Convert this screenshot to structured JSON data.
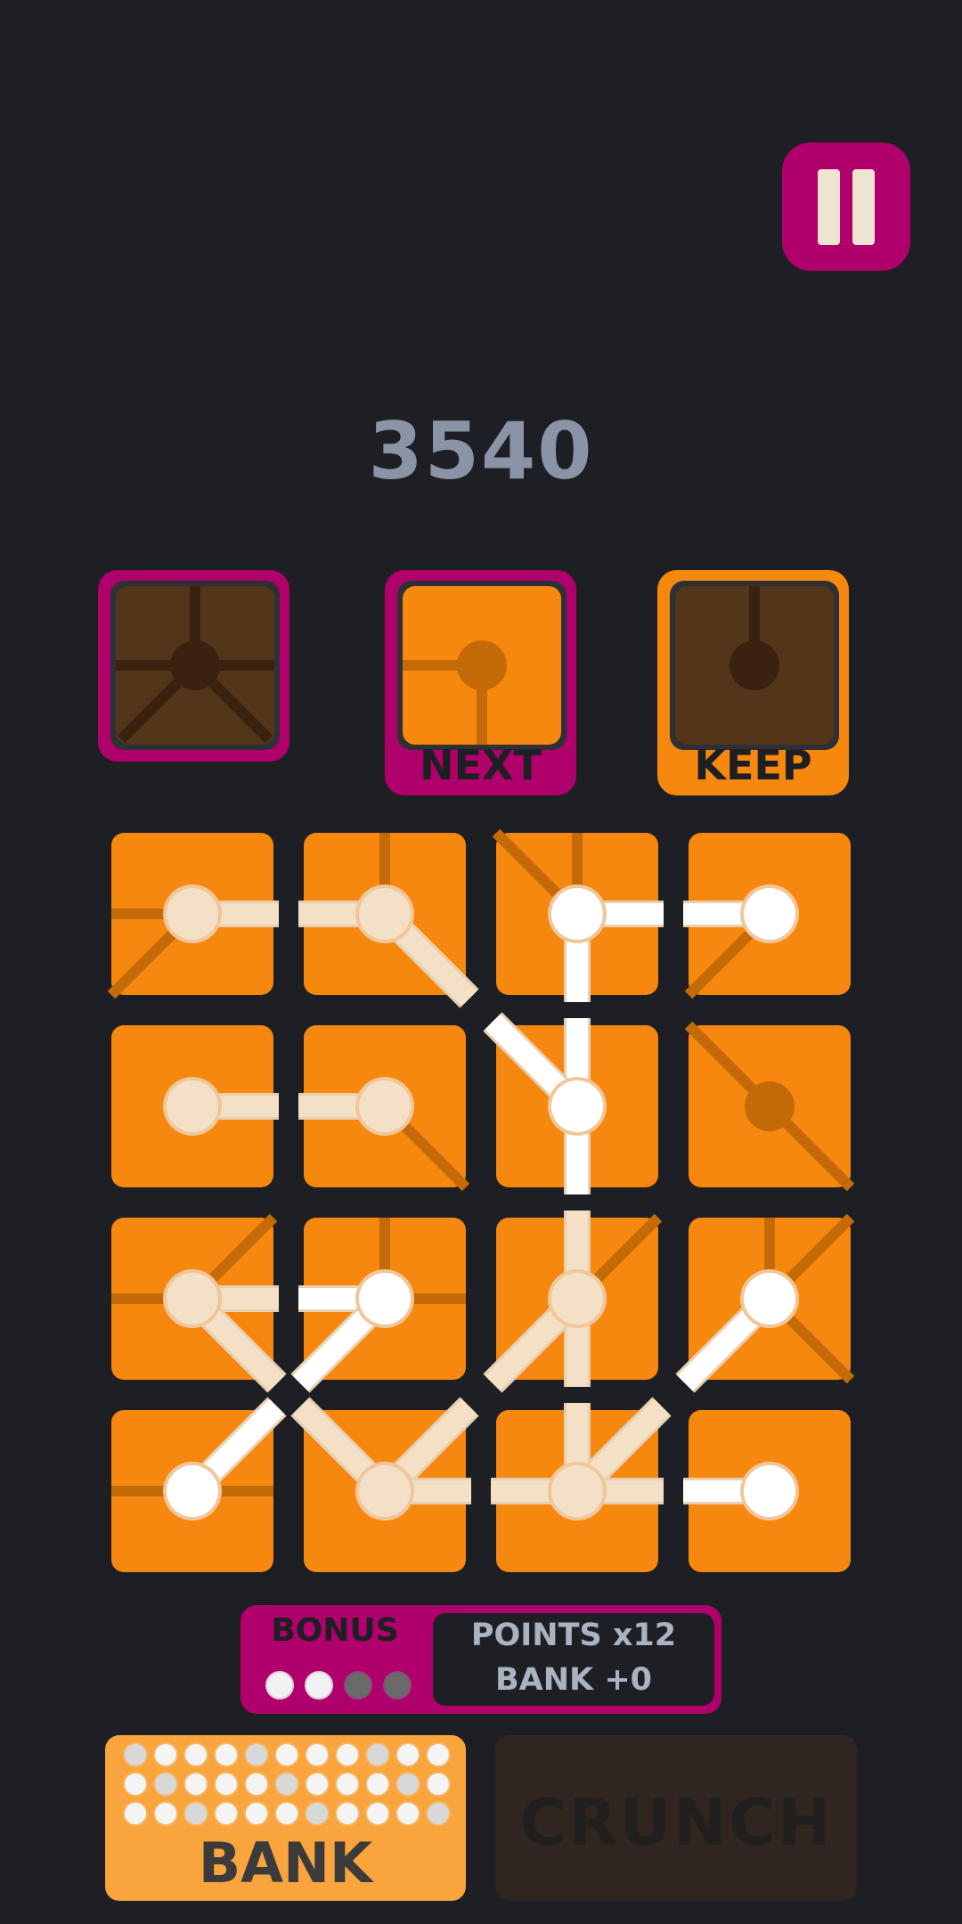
{
  "score": "3540",
  "slots": {
    "next_label": "NEXT",
    "keep_label": "KEEP"
  },
  "grid": {
    "rows": 4,
    "cols": 4,
    "tiles": [
      {
        "lines": [
          "w",
          "sw"
        ],
        "arms": [
          "e"
        ],
        "hub": "cream"
      },
      {
        "lines": [
          "n"
        ],
        "arms": [
          "w",
          "se"
        ],
        "hub": "cream"
      },
      {
        "lines": [
          "n",
          "nw"
        ],
        "arms": [
          "e",
          "s"
        ],
        "hub": "white"
      },
      {
        "lines": [
          "sw"
        ],
        "arms": [
          "w"
        ],
        "hub": "white"
      },
      {
        "lines": [],
        "arms": [
          "e"
        ],
        "hub": "cream"
      },
      {
        "lines": [
          "se"
        ],
        "arms": [
          "w"
        ],
        "hub": "cream"
      },
      {
        "lines": [],
        "arms": [
          "n",
          "nw",
          "s"
        ],
        "hub": "white"
      },
      {
        "lines": [
          "nw",
          "se"
        ],
        "arms": [],
        "hub": "dark"
      },
      {
        "lines": [
          "w",
          "ne"
        ],
        "arms": [
          "e",
          "se"
        ],
        "hub": "cream"
      },
      {
        "lines": [
          "n",
          "e"
        ],
        "arms": [
          "w",
          "sw"
        ],
        "hub": "white"
      },
      {
        "lines": [
          "ne"
        ],
        "arms": [
          "n",
          "s",
          "sw"
        ],
        "hub": "cream"
      },
      {
        "lines": [
          "n",
          "ne",
          "se"
        ],
        "arms": [
          "sw"
        ],
        "hub": "white"
      },
      {
        "lines": [
          "w",
          "e"
        ],
        "arms": [
          "ne"
        ],
        "hub": "white"
      },
      {
        "lines": [],
        "arms": [
          "nw",
          "ne",
          "e"
        ],
        "hub": "cream"
      },
      {
        "lines": [],
        "arms": [
          "n",
          "ne",
          "e",
          "w"
        ],
        "hub": "cream"
      },
      {
        "lines": [],
        "arms": [
          "w"
        ],
        "hub": "white"
      }
    ]
  },
  "bonus": {
    "label": "BONUS",
    "dots": [
      "filled",
      "filled",
      "empty",
      "empty"
    ],
    "points_text": "POINTS x12",
    "bank_text": "BANK +0"
  },
  "bank": {
    "label": "BANK",
    "dots_filled": 33
  },
  "crunch": {
    "label": "CRUNCH"
  },
  "colors": {
    "background": "#1d1f24",
    "tile": "#f6870f",
    "tile_line": "#c56a08",
    "magenta": "#b0006c",
    "arm_white": "#ffffff",
    "arm_cream": "#f3e0c6",
    "disabled_tile": "#533519"
  },
  "icons": {
    "pause": "pause-icon"
  }
}
